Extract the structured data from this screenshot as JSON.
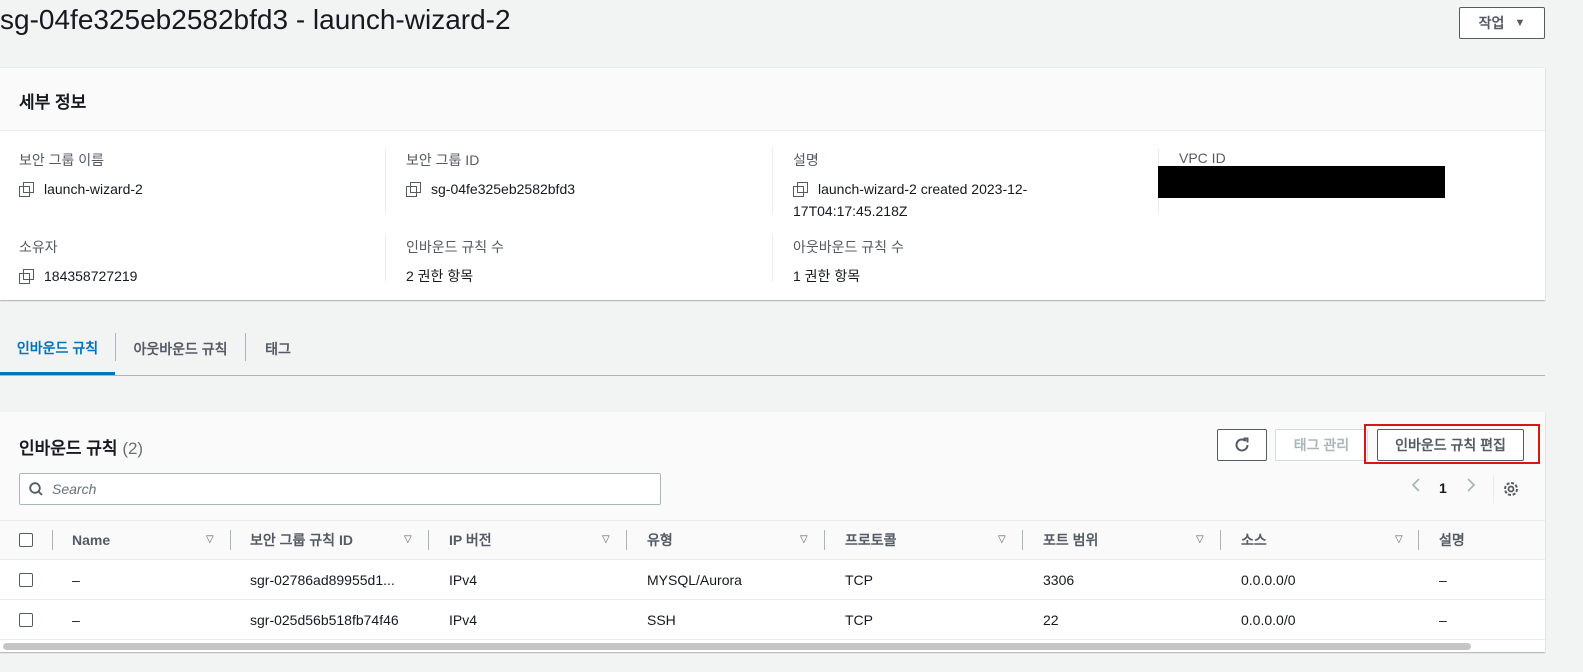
{
  "page": {
    "title": "sg-04fe325eb2582bfd3 - launch-wizard-2",
    "actions_label": "작업"
  },
  "details": {
    "header": "세부 정보",
    "sg_name_label": "보안 그룹 이름",
    "sg_name": "launch-wizard-2",
    "sg_id_label": "보안 그룹 ID",
    "sg_id": "sg-04fe325eb2582bfd3",
    "desc_label": "설명",
    "desc_line1": "launch-wizard-2 created 2023-12-",
    "desc_line2": "17T04:17:45.218Z",
    "vpc_label": "VPC ID",
    "owner_label": "소유자",
    "owner": "184358727219",
    "inbound_count_label": "인바운드 규칙 수",
    "inbound_count": "2 권한 항목",
    "outbound_count_label": "아웃바운드 규칙 수",
    "outbound_count": "1 권한 항목"
  },
  "tabs": [
    {
      "label": "인바운드 규칙",
      "active": true
    },
    {
      "label": "아웃바운드 규칙"
    },
    {
      "label": "태그"
    }
  ],
  "rules": {
    "title": "인바운드 규칙",
    "count": "(2)",
    "manage_tags": "태그 관리",
    "edit_rules": "인바운드 규칙 편집",
    "search_placeholder": "Search",
    "page": "1",
    "columns": [
      "Name",
      "보안 그룹 규칙 ID",
      "IP 버전",
      "유형",
      "프로토콜",
      "포트 범위",
      "소스",
      "설명"
    ],
    "rows": [
      [
        "–",
        "sgr-02786ad89955d1...",
        "IPv4",
        "MYSQL/Aurora",
        "TCP",
        "3306",
        "0.0.0.0/0",
        "–"
      ],
      [
        "–",
        "sgr-025d56b518fb74f46",
        "IPv4",
        "SSH",
        "TCP",
        "22",
        "0.0.0.0/0",
        "–"
      ]
    ]
  },
  "colors": {
    "accent": "#0073bb",
    "highlight": "#d91515"
  }
}
